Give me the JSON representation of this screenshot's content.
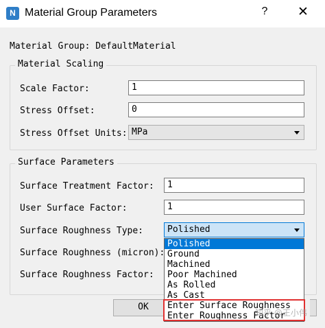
{
  "window": {
    "title": "Material Group Parameters",
    "help_label": "?",
    "close_label": "✕",
    "icon_text": "N",
    "icon_name": "app-logo-icon"
  },
  "header": {
    "material_group": "Material Group: DefaultMaterial"
  },
  "material_scaling": {
    "title": "Material Scaling",
    "scale_factor_label": "Scale Factor:",
    "scale_factor_value": "1",
    "stress_offset_label": "Stress Offset:",
    "stress_offset_value": "0",
    "stress_offset_units_label": "Stress Offset Units:",
    "stress_offset_units_value": "MPa"
  },
  "surface_parameters": {
    "title": "Surface Parameters",
    "treatment_factor_label": "Surface Treatment Factor:",
    "treatment_factor_value": "1",
    "user_surface_factor_label": "User Surface Factor:",
    "user_surface_factor_value": "1",
    "roughness_type_label": "Surface Roughness Type:",
    "roughness_type_value": "Polished",
    "roughness_micron_label": "Surface Roughness (micron):",
    "roughness_factor_label": "Surface Roughness Factor:"
  },
  "roughness_options": [
    "Polished",
    "Ground",
    "Machined",
    "Poor Machined",
    "As Rolled",
    "As Cast",
    "Enter Surface Roughness",
    "Enter Roughness Factor"
  ],
  "buttons": {
    "ok_label": "OK"
  },
  "watermark": "知乎 @王小伟",
  "colors": {
    "selection": "#0078d7",
    "highlight_box": "#e03030"
  }
}
